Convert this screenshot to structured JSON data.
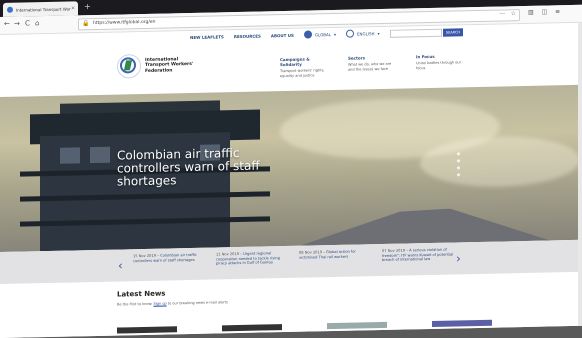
{
  "browser": {
    "tab_title": "International Transport Work...",
    "tab_close": "×",
    "new_tab": "+",
    "window_controls": "— □ ✕",
    "url": "https://www.itfglobal.org/en",
    "url_dots": "···",
    "back": "←",
    "forward": "→",
    "reload": "C",
    "home": "⌂"
  },
  "site": {
    "nav": {
      "link1": "NEW LEAFLETS",
      "link2": "RESOURCES",
      "link3": "ABOUT US",
      "region": "GLOBAL",
      "language": "ENGLISH",
      "search_placeholder": "",
      "search_button": "SEARCH"
    },
    "logo_text": "International\nTransport Workers'\nFederation",
    "columns": [
      {
        "heading": "Campaigns & Solidarity",
        "desc": "Transport workers' rights, equality and justice"
      },
      {
        "heading": "Sectors",
        "desc": "What we do, who we are and the issues we face"
      },
      {
        "heading": "In Focus",
        "desc": "Union battles through our focus"
      }
    ],
    "hero": {
      "title": "Colombian air traffic controllers warn of staff shortages"
    },
    "news": [
      {
        "date": "15 Nov 2019",
        "text": "Colombian air traffic controllers warn of staff shortages"
      },
      {
        "date": "11 Nov 2019",
        "text": "Urgent regional cooperation needed to tackle rising piracy attacks in Gulf of Guinea"
      },
      {
        "date": "08 Nov 2019",
        "text": "Global action for victimised Thai rail workers"
      },
      {
        "date": "07 Nov 2019",
        "text": "A serious violation of freedom\": ITF warns Kuwait of potential breach of international law"
      }
    ],
    "latest": {
      "title": "Latest News",
      "sub_before": "Be the first to know:",
      "sub_link": "Sign up",
      "sub_after": "to our breaking news e-mail alerts"
    }
  }
}
